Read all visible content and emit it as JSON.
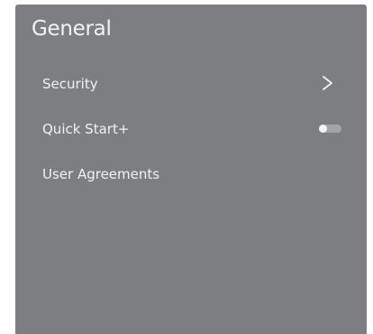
{
  "panel": {
    "title": "General"
  },
  "menu": {
    "items": [
      {
        "label": "Security",
        "control": "chevron-right-icon"
      },
      {
        "label": "Quick Start+",
        "control": "toggle",
        "toggle_on": false
      },
      {
        "label": "User Agreements",
        "control": "none"
      }
    ]
  },
  "colors": {
    "panel_background": "#7d7e81",
    "text": "#f2f2f2",
    "toggle_track": "#a3a4a7"
  }
}
